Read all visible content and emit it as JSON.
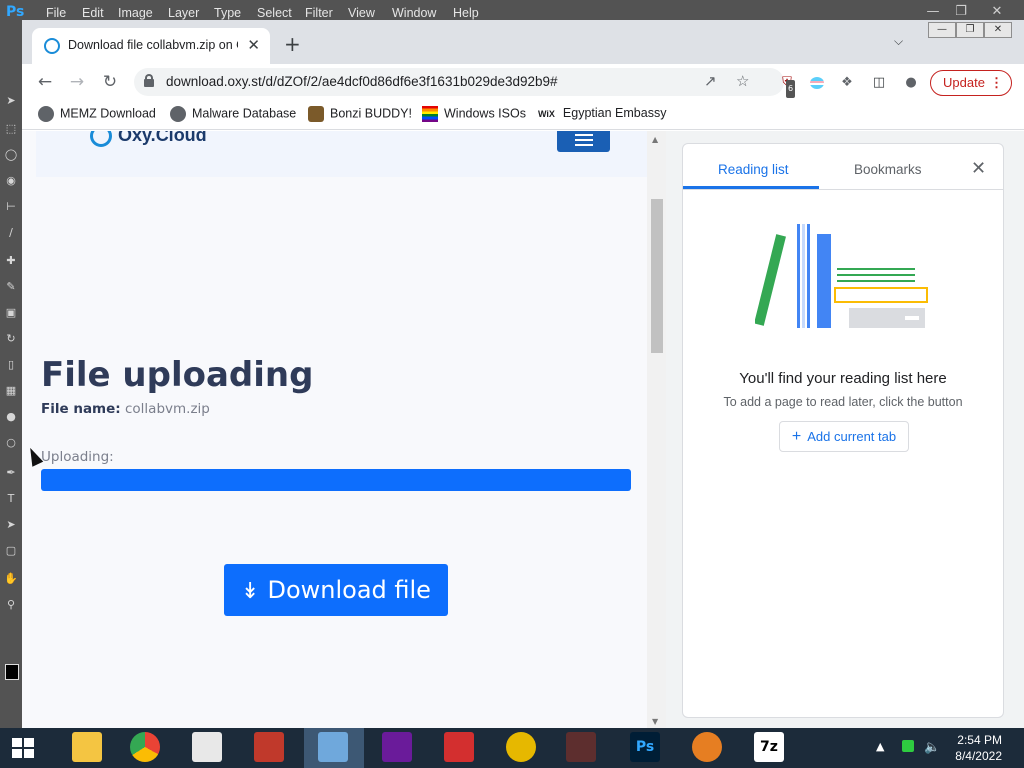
{
  "photoshop": {
    "logo": "Ps",
    "menu": [
      "File",
      "Edit",
      "Image",
      "Layer",
      "Type",
      "Select",
      "Filter",
      "View",
      "Window",
      "Help"
    ]
  },
  "browser": {
    "tab_title": "Download file collabvm.zip on O",
    "url": "download.oxy.st/d/dZOf/2/ae4dcf0d86df6e3f1631b029de3d92b9#",
    "extension_badge": "6",
    "update_label": "Update",
    "bookmarks": [
      "MEMZ Download",
      "Malware Database",
      "Bonzi BUDDY!",
      "Windows ISOs",
      "Egyptian Embassy"
    ],
    "bookmark_wix_logo": "WiX"
  },
  "page": {
    "site_name": "Oxy.Cloud",
    "heading": "File uploading",
    "file_name_label": "File name:",
    "file_name": "collabvm.zip",
    "uploading_label": "Uploading:",
    "upload_progress_percent": 100,
    "download_button": "Download file",
    "accent_color": "#0d6efd"
  },
  "side_panel": {
    "tabs": [
      "Reading list",
      "Bookmarks"
    ],
    "active_tab": "Reading list",
    "heading": "You'll find your reading list here",
    "subtext": "To add a page to read later, click the button",
    "add_button": "Add current tab"
  },
  "taskbar": {
    "apps": [
      "file-explorer",
      "chrome",
      "solitaire",
      "paint",
      "control-panel",
      "yahoo-messenger",
      "acrobat",
      "disc",
      "game",
      "photoshop",
      "paint-brush",
      "7zip"
    ],
    "seven_zip_label": "7z",
    "clock_time": "2:54 PM",
    "clock_date": "8/4/2022"
  }
}
